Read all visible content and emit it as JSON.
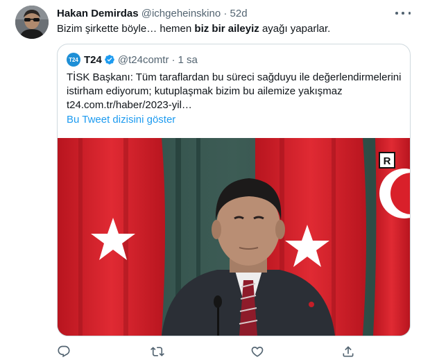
{
  "tweet": {
    "author_name": "Hakan Demirdas",
    "author_handle": "@ichgeheinskino",
    "separator": "·",
    "time": "52d",
    "text_before": "Bizim şirkette böyle… hemen ",
    "text_bold": "biz bir aileyiz",
    "text_after": " ayağı yaparlar."
  },
  "quote": {
    "avatar_label": "T24",
    "author_name": "T24",
    "author_handle": "@t24comtr",
    "separator": "·",
    "time": "1 sa",
    "lines": [
      "TİSK Başkanı: Tüm taraflardan bu süreci sağduyu ile değerlendirmelerini",
      "istirham ediyorum; kutuplaşmak bizim bu ailemize yakışmaz",
      "t24.com.tr/haber/2023-yil…"
    ],
    "show_thread": "Bu Tweet dizisini göster",
    "media_badge": "R"
  },
  "colors": {
    "accent": "#1d9bf0",
    "text": "#0f1419",
    "muted": "#536471",
    "border": "#cfd9de",
    "flag_red": "#d9202a"
  },
  "icons": [
    "more-icon",
    "verified-icon",
    "reply-icon",
    "retweet-icon",
    "like-icon",
    "share-icon"
  ]
}
